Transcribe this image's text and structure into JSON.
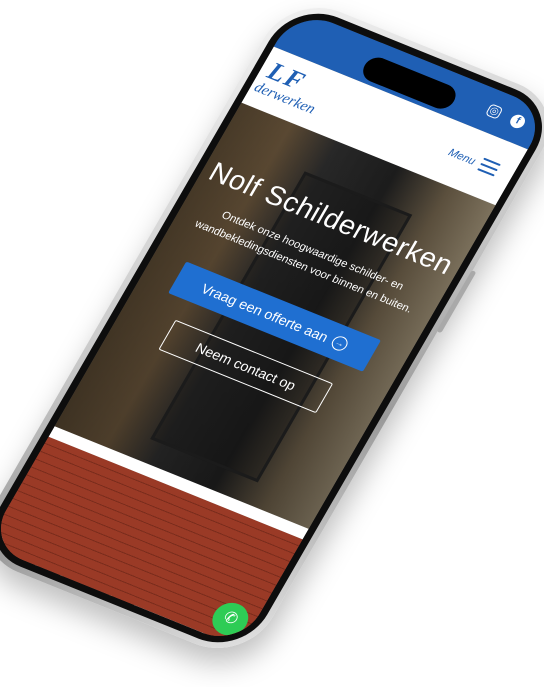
{
  "header": {
    "logo_text": "LF",
    "logo_subtitle": "derwerken",
    "menu_label": "Menu"
  },
  "social": {
    "instagram_icon": "instagram-icon",
    "facebook_icon": "facebook-icon"
  },
  "hero": {
    "title": "Nolf Schilderwerken",
    "subtitle": "Ontdek onze hoogwaardige schilder- en wandbekledingsdiensten voor binnen en buiten.",
    "primary_button": "Vraag een offerte aan",
    "secondary_button": "Neem contact op"
  },
  "colors": {
    "brand_blue": "#1f5fb4",
    "button_blue": "#1f6fd1",
    "whatsapp_green": "#2ecc55"
  }
}
